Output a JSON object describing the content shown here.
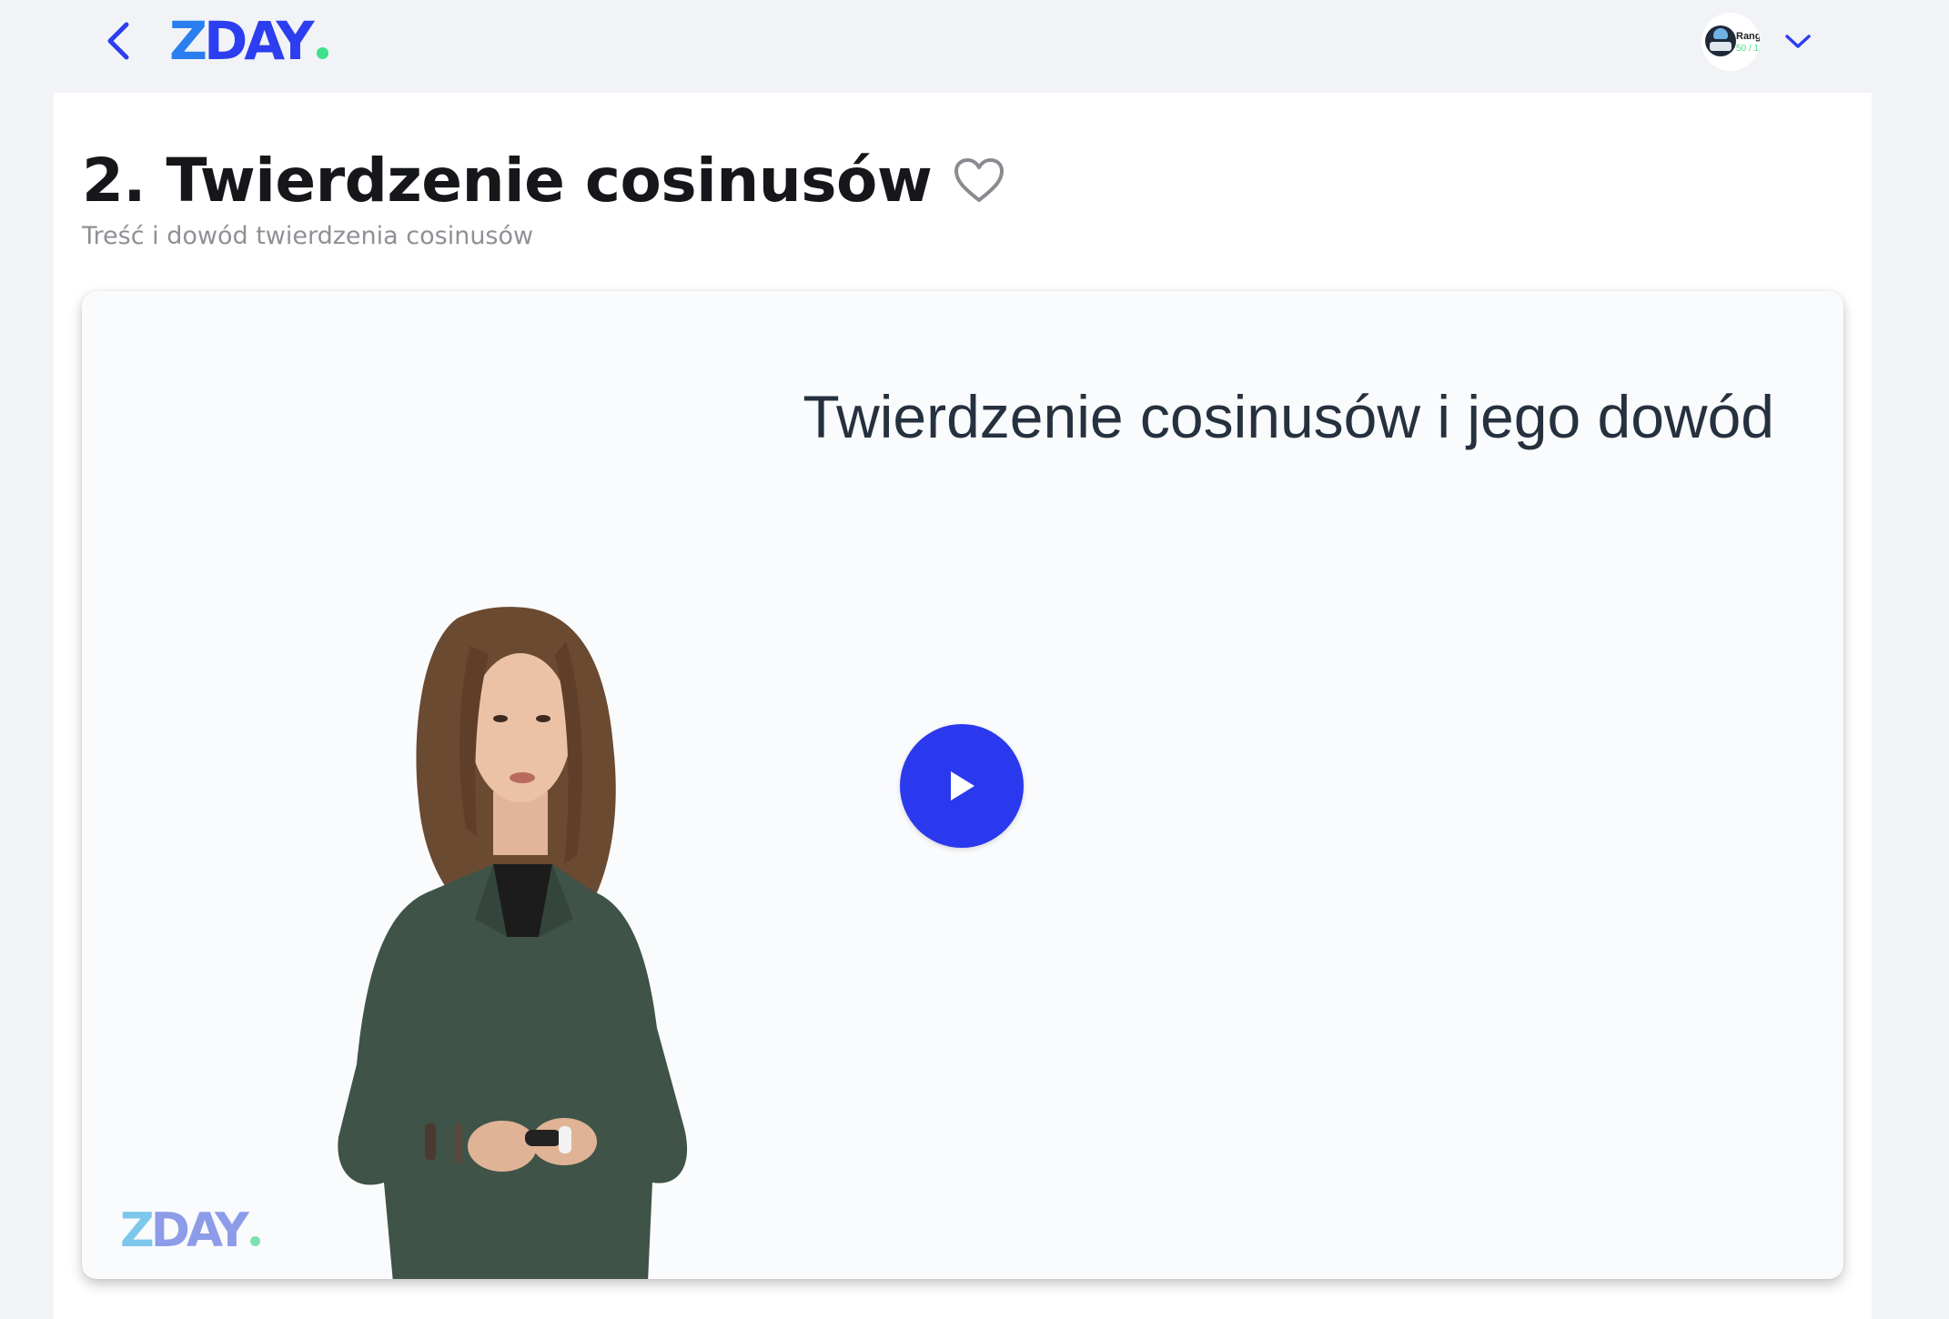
{
  "header": {
    "logo_text": "ZDAY",
    "logo_first": "Z",
    "logo_rest": "DAY",
    "user": {
      "rank_label": "Ranga",
      "rank_value": "50 / 1"
    }
  },
  "lesson": {
    "title": "2. Twierdzenie cosinusów",
    "subtitle": "Treść i dowód twierdzenia cosinusów"
  },
  "video": {
    "slide_title": "Twierdzenie cosinusów i jego dowód",
    "watermark_first": "Z",
    "watermark_rest": "DAY"
  },
  "icons": {
    "back": "chevron-left-icon",
    "favorite": "heart-outline-icon",
    "menu": "chevron-down-icon",
    "play": "play-icon"
  },
  "colors": {
    "brand_blue": "#2c3ef0",
    "brand_green": "#3fe08a",
    "play_button": "#2b39ee",
    "page_background": "#f2f3f6"
  }
}
